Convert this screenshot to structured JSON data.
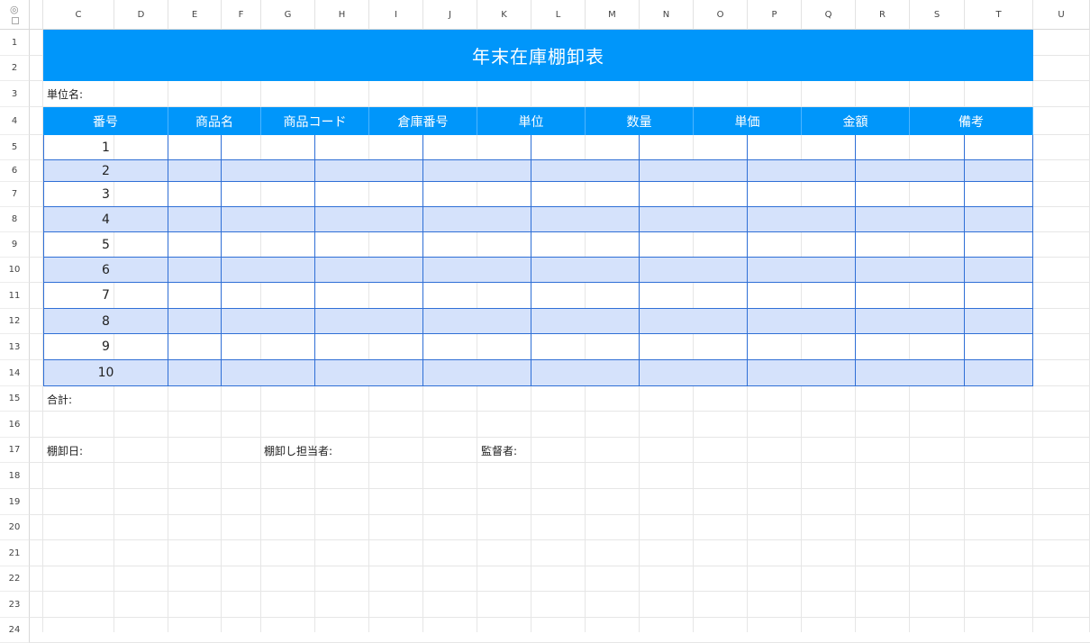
{
  "columns": [
    "C",
    "D",
    "E",
    "F",
    "G",
    "H",
    "I",
    "J",
    "K",
    "L",
    "M",
    "N",
    "O",
    "P",
    "Q",
    "R",
    "S",
    "T",
    "U"
  ],
  "rows": [
    "1",
    "2",
    "3",
    "4",
    "5",
    "6",
    "7",
    "8",
    "9",
    "10",
    "11",
    "12",
    "13",
    "14",
    "15",
    "16",
    "17",
    "18",
    "19",
    "20",
    "21",
    "22",
    "23",
    "24"
  ],
  "title": "年末在庫棚卸表",
  "unit_label": "単位名:",
  "table": {
    "headers": [
      "番号",
      "商品名",
      "商品コード",
      "倉庫番号",
      "単位",
      "数量",
      "単価",
      "金額",
      "備考"
    ],
    "row_numbers": [
      "1",
      "2",
      "3",
      "4",
      "5",
      "6",
      "7",
      "8",
      "9",
      "10"
    ]
  },
  "total_label": "合計:",
  "footer": {
    "date_label": "棚卸日:",
    "person_label": "棚卸し担当者:",
    "supervisor_label": "監督者:"
  },
  "colors": {
    "header_blue": "#0096FA",
    "band_row": "#D5E2FB",
    "table_border": "#2F6FD6"
  },
  "icons": [
    "eye-icon",
    "select-all-icon"
  ]
}
